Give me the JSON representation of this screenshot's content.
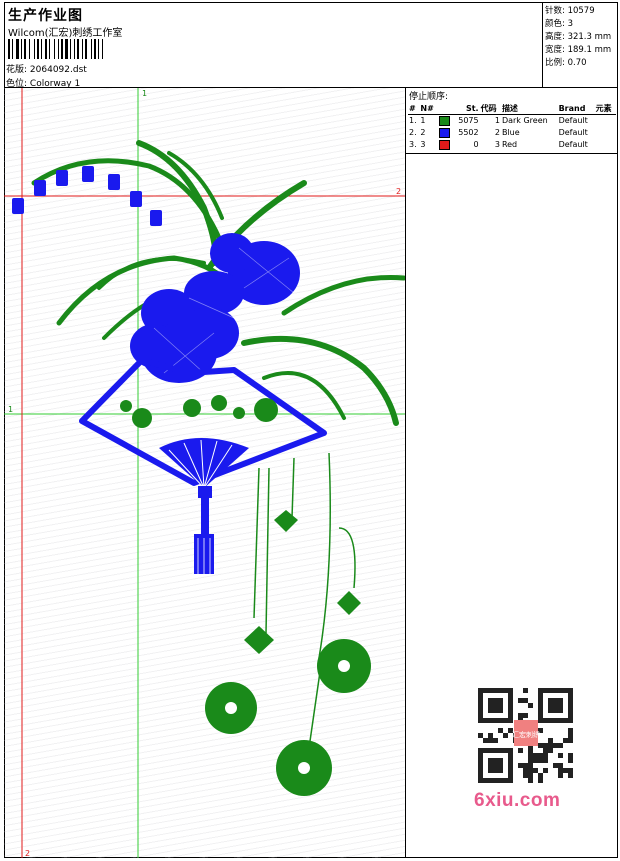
{
  "header": {
    "title": "生产作业图",
    "company": "Wilcom(汇宏)刺绣工作室",
    "filename_label": "花版:",
    "filename": "2064092.dst",
    "colorway_label": "色位:",
    "colorway": "Colorway 1"
  },
  "stats": {
    "stitches_label": "针数:",
    "stitches": "10579",
    "colors_label": "颜色:",
    "colors": "3",
    "height_label": "高度:",
    "height": "321.3 mm",
    "width_label": "宽度:",
    "width": "189.1 mm",
    "scale_label": "比例:",
    "scale": "0.70"
  },
  "stop_sequence": {
    "heading": "停止顺序:",
    "columns": [
      "#",
      "N#",
      "St.",
      "代码",
      "描述",
      "Brand",
      "元素"
    ],
    "rows": [
      {
        "num": "1.",
        "needle": "1",
        "color": "#1a8a1a",
        "stitches": "5075",
        "code": "1",
        "desc": "Dark Green",
        "brand": "Default"
      },
      {
        "num": "2.",
        "needle": "2",
        "color": "#1a1aee",
        "stitches": "5502",
        "code": "2",
        "desc": "Blue",
        "brand": "Default"
      },
      {
        "num": "3.",
        "needle": "3",
        "color": "#e11a1a",
        "stitches": "0",
        "code": "3",
        "desc": "Red",
        "brand": "Default"
      }
    ]
  },
  "guides": {
    "v1_label": "1",
    "h1_label": "1",
    "h2_label": "2",
    "v2_label": "2"
  },
  "colors": {
    "green": "#1a8a1a",
    "blue": "#1a1aee",
    "red": "#e11a1a",
    "guide_green": "#33cc33"
  },
  "watermark": {
    "text": "6xiu.com",
    "badge": "汇宏刺绣"
  }
}
